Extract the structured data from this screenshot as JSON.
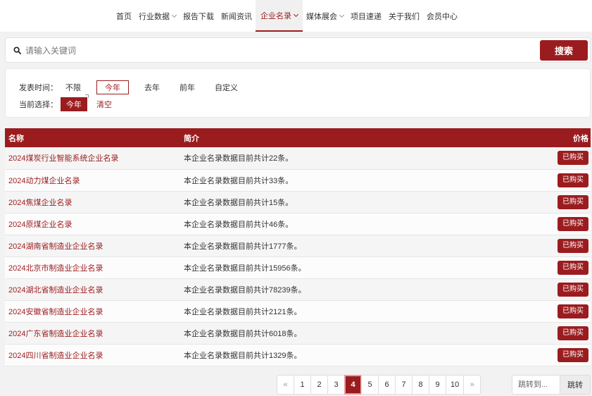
{
  "nav": {
    "items": [
      {
        "label": "首页",
        "dropdown": false,
        "active": false
      },
      {
        "label": "行业数据",
        "dropdown": true,
        "active": false
      },
      {
        "label": "报告下载",
        "dropdown": false,
        "active": false
      },
      {
        "label": "新闻资讯",
        "dropdown": false,
        "active": false
      },
      {
        "label": "企业名录",
        "dropdown": true,
        "active": true
      },
      {
        "label": "媒体展会",
        "dropdown": true,
        "active": false
      },
      {
        "label": "项目速递",
        "dropdown": false,
        "active": false
      },
      {
        "label": "关于我们",
        "dropdown": false,
        "active": false
      },
      {
        "label": "会员中心",
        "dropdown": false,
        "active": false
      }
    ]
  },
  "search": {
    "placeholder": "请输入关键词",
    "value": "",
    "button_label": "搜索"
  },
  "filter": {
    "time_label": "发表时间：",
    "options": [
      "不限",
      "今年",
      "去年",
      "前年",
      "自定义"
    ],
    "selected_option": "今年",
    "current_label": "当前选择：",
    "current_chip": "今年",
    "clear_label": "清空"
  },
  "table": {
    "headers": {
      "name": "名称",
      "desc": "简介",
      "price": "价格"
    },
    "rows": [
      {
        "name": "2024煤炭行业智能系统企业名录",
        "desc": "本企业名录数据目前共计22条。",
        "action": "已购买"
      },
      {
        "name": "2024动力煤企业名录",
        "desc": "本企业名录数据目前共计33条。",
        "action": "已购买"
      },
      {
        "name": "2024焦煤企业名录",
        "desc": "本企业名录数据目前共计15条。",
        "action": "已购买"
      },
      {
        "name": "2024原煤企业名录",
        "desc": "本企业名录数据目前共计46条。",
        "action": "已购买"
      },
      {
        "name": "2024湖南省制造业企业名录",
        "desc": "本企业名录数据目前共计1777条。",
        "action": "已购买"
      },
      {
        "name": "2024北京市制造业企业名录",
        "desc": "本企业名录数据目前共计15956条。",
        "action": "已购买"
      },
      {
        "name": "2024湖北省制造业企业名录",
        "desc": "本企业名录数据目前共计78239条。",
        "action": "已购买"
      },
      {
        "name": "2024安徽省制造业企业名录",
        "desc": "本企业名录数据目前共计2121条。",
        "action": "已购买"
      },
      {
        "name": "2024广东省制造业企业名录",
        "desc": "本企业名录数据目前共计6018条。",
        "action": "已购买"
      },
      {
        "name": "2024四川省制造业企业名录",
        "desc": "本企业名录数据目前共计1329条。",
        "action": "已购买"
      }
    ]
  },
  "pagination": {
    "prev": "«",
    "pages": [
      "1",
      "2",
      "3",
      "4",
      "5",
      "6",
      "7",
      "8",
      "9",
      "10"
    ],
    "current": "4",
    "next": "»",
    "jump_placeholder": "跳转到...",
    "jump_button": "跳转"
  },
  "colors": {
    "accent": "#9b1c1f"
  }
}
